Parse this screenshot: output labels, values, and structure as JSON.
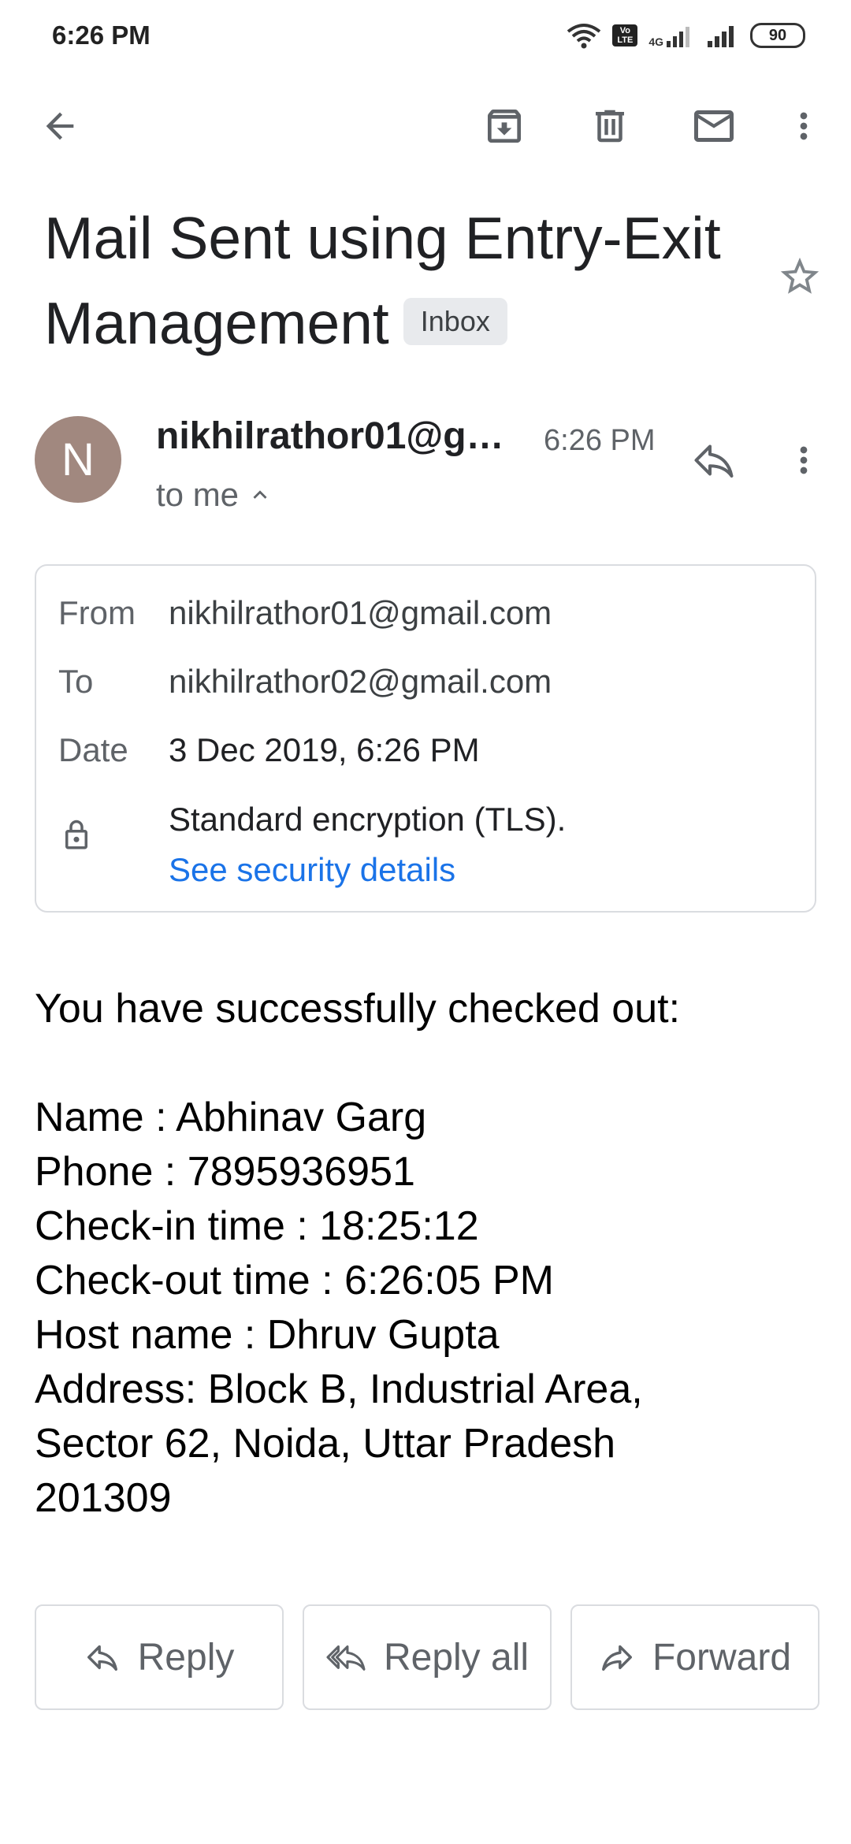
{
  "status_bar": {
    "time": "6:26 PM",
    "network": "4G",
    "volte": "Vo LTE",
    "battery": "90",
    "icons": [
      "wifi-icon",
      "volte-icon",
      "signal-icon",
      "signal-icon",
      "battery-icon"
    ]
  },
  "toolbar": {
    "icons": [
      "back-arrow-icon",
      "archive-icon",
      "delete-icon",
      "mark-unread-icon",
      "more-vert-icon"
    ]
  },
  "email": {
    "subject": "Mail Sent using Entry-Exit Management",
    "label": "Inbox",
    "sender_avatar_letter": "N",
    "sender_display": "nikhilrathor01@g…",
    "time": "6:26 PM",
    "recipient_summary": "to me"
  },
  "details": {
    "from_label": "From",
    "from_value": "nikhilrathor01@gmail.com",
    "to_label": "To",
    "to_value": "nikhilrathor02@gmail.com",
    "date_label": "Date",
    "date_value": "3 Dec 2019, 6:26 PM",
    "encryption": "Standard encryption (TLS).",
    "security_link": "See security details"
  },
  "body": {
    "intro": "You have successfully checked out:",
    "lines": [
      "Name : Abhinav Garg",
      "Phone : 7895936951",
      "Check-in time : 18:25:12",
      "Check-out time : 6:26:05 PM",
      "Host name : Dhruv Gupta",
      "Address: Block B, Industrial Area,",
      "Sector 62, Noida, Uttar Pradesh",
      "201309"
    ]
  },
  "actions": {
    "reply": "Reply",
    "reply_all": "Reply all",
    "forward": "Forward"
  },
  "colors": {
    "avatar": "#a1887f",
    "link": "#1a73e8",
    "chip_bg": "#e8eaed",
    "border": "#dadce0"
  }
}
